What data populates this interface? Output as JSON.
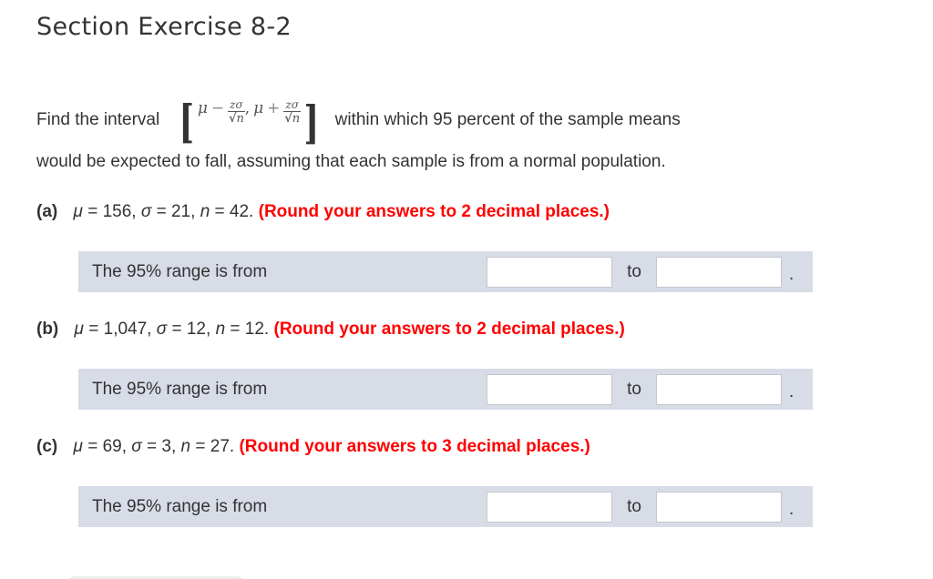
{
  "page": {
    "title": "Section Exercise 8-2"
  },
  "intro": {
    "before_formula": "Find the interval",
    "formula": {
      "mu": "μ",
      "minus": "−",
      "plus": "+",
      "numerator": "zσ",
      "radical": "√",
      "n": "n",
      "comma": ",",
      "left_bracket": "[",
      "right_bracket": "]"
    },
    "after_formula": "within which 95 percent of the sample means",
    "line2": "would be expected to fall, assuming that each sample is from a normal population."
  },
  "parts": [
    {
      "letter": "(a)",
      "mu_label": "μ",
      "mu_value": " = 156, ",
      "sigma_label": "σ",
      "sigma_value": " = 21, ",
      "n_label": "n",
      "n_value": " = 42. ",
      "instruction": "(Round your answers to 2 decimal places.)",
      "prompt": "The 95% range is from",
      "to_label": "to",
      "period": ".",
      "from_value": "",
      "to_value": ""
    },
    {
      "letter": "(b)",
      "mu_label": "μ",
      "mu_value": " = 1,047, ",
      "sigma_label": "σ",
      "sigma_value": " = 12, ",
      "n_label": "n",
      "n_value": " = 12. ",
      "instruction": "(Round your answers to 2 decimal places.)",
      "prompt": "The 95% range is from",
      "to_label": "to",
      "period": ".",
      "from_value": "",
      "to_value": ""
    },
    {
      "letter": "(c)",
      "mu_label": "μ",
      "mu_value": " = 69, ",
      "sigma_label": "σ",
      "sigma_value": " = 3, ",
      "n_label": "n",
      "n_value": " = 27. ",
      "instruction": "(Round your answers to 3 decimal places.)",
      "prompt": "The 95% range is from",
      "to_label": "to",
      "period": ".",
      "from_value": "",
      "to_value": ""
    }
  ],
  "colors": {
    "instruction_red": "#ff0000",
    "answer_row_bg": "#d7dce7",
    "text": "#333333"
  }
}
